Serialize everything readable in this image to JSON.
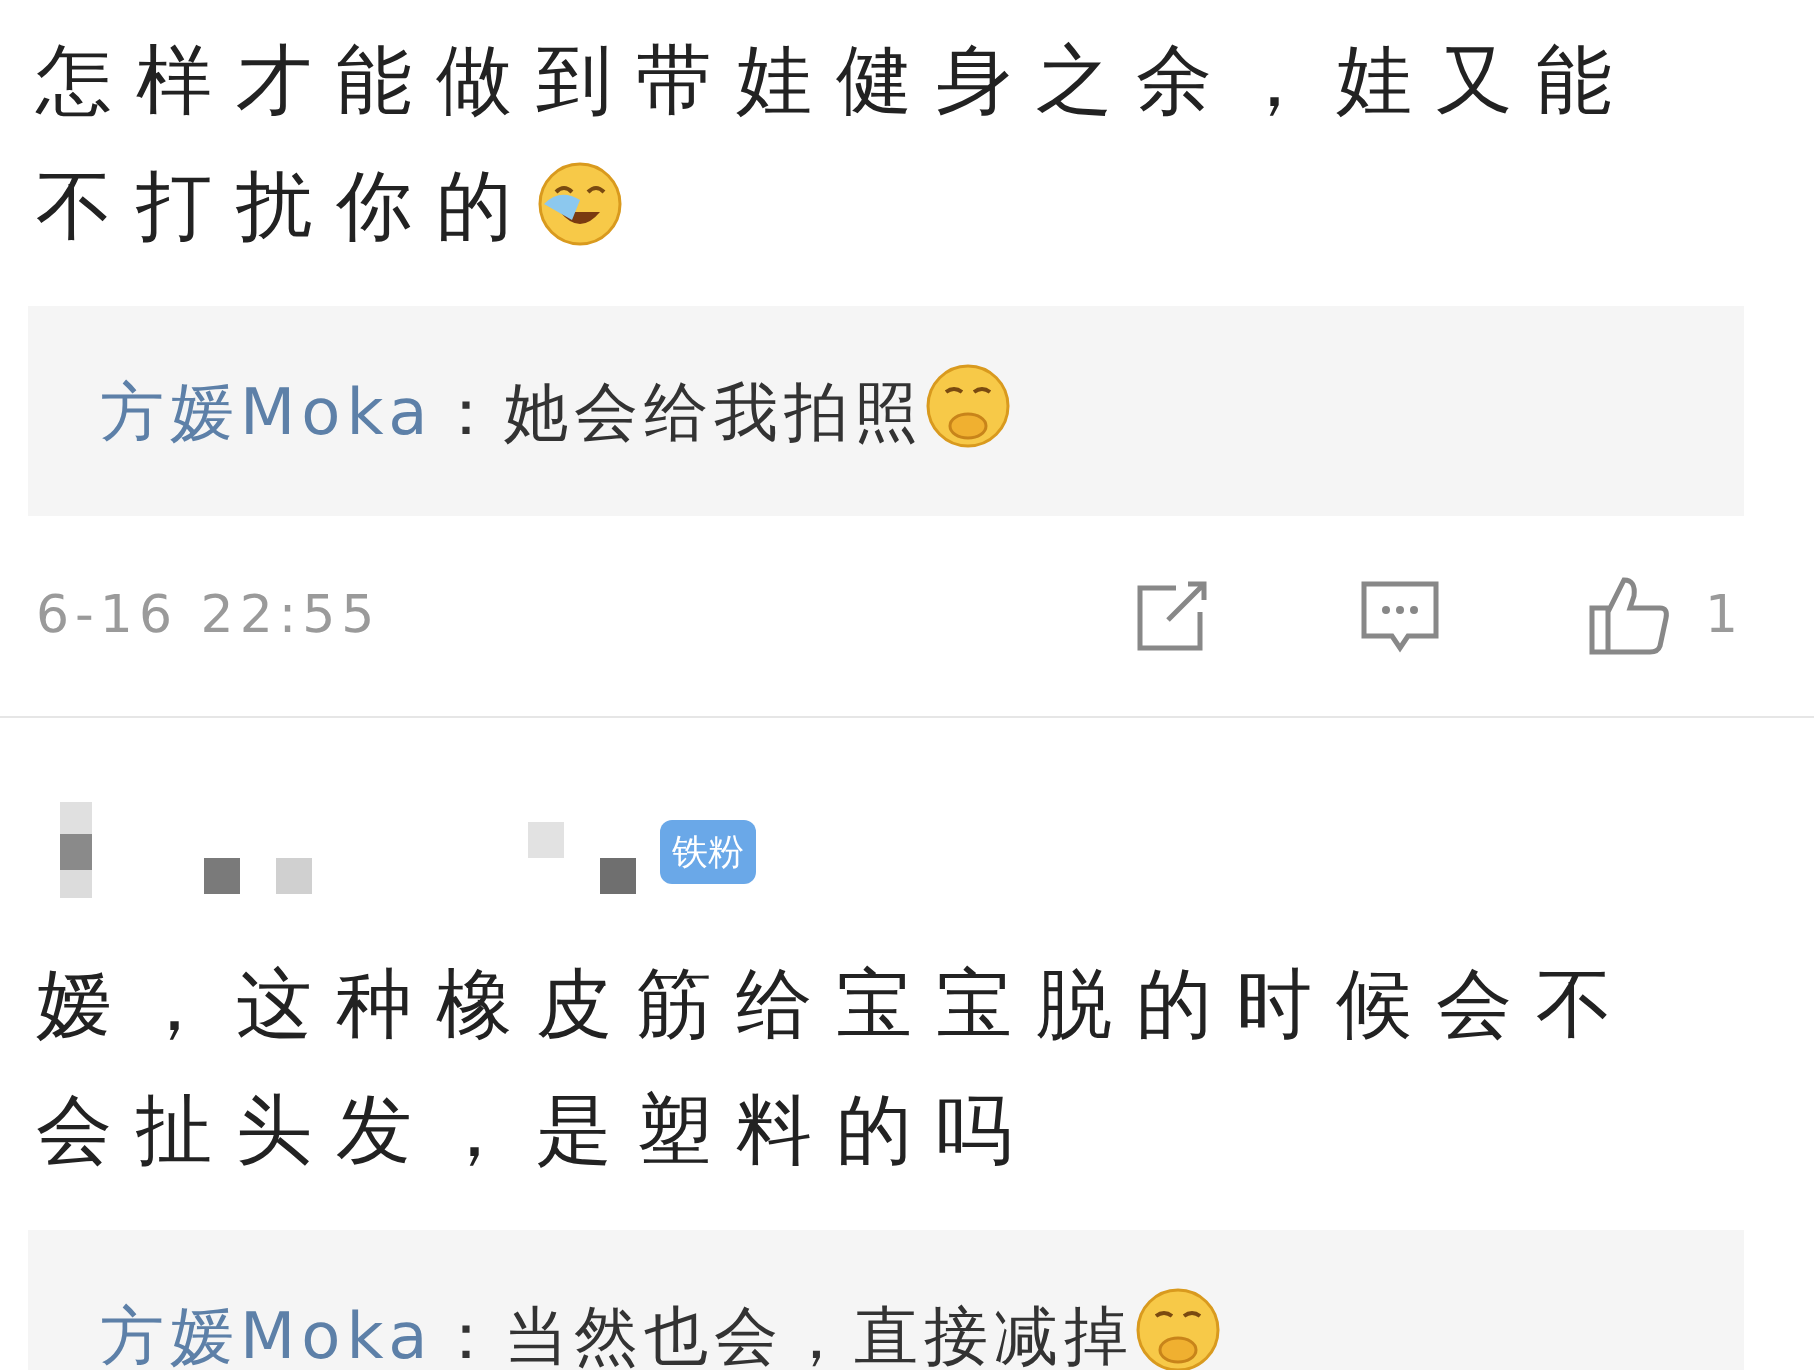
{
  "comments": [
    {
      "lines": [
        "怎样才能做到带娃健身之余，娃又能",
        "不打扰你的"
      ],
      "emoji": true,
      "reply": {
        "author": "方媛Moka",
        "text": "：她会给我拍照",
        "emoji": true
      },
      "meta": {
        "time": "6-16 22:55",
        "likes": "1"
      }
    },
    {
      "badge": "铁粉",
      "lines": [
        "嫒，这种橡皮筋给宝宝脱的时候会不",
        "会扯头发，是塑料的吗"
      ],
      "emoji": false,
      "reply": {
        "author": "方媛Moka",
        "text": "：当然也会，直接减掉",
        "emoji": true
      }
    }
  ]
}
